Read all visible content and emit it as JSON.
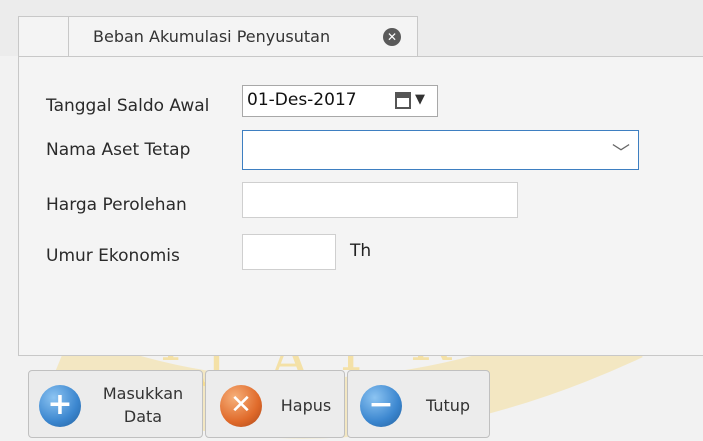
{
  "tab": {
    "title": "Beban Akumulasi Penyusutan",
    "close_glyph": "✕"
  },
  "form": {
    "tanggal_label": "Tanggal Saldo Awal",
    "tanggal_value": "01-Des-2017",
    "nama_aset_label": "Nama Aset Tetap",
    "nama_aset_value": "",
    "harga_label": "Harga Perolehan",
    "harga_value": "",
    "umur_label": "Umur Ekonomis",
    "umur_value": "",
    "umur_unit": "Th"
  },
  "buttons": {
    "masukkan_line1": "Masukkan",
    "masukkan_line2": "Data",
    "hapus": "Hapus",
    "tutup": "Tutup"
  },
  "icons": {
    "tab_close": "close-icon",
    "calendar": "calendar-icon",
    "dropdown": "chevron-down-icon",
    "add": "plus-icon",
    "delete": "x-icon",
    "close": "minus-icon"
  },
  "colors": {
    "combo_border": "#3e7fc1",
    "add_icon": "#3b86cf",
    "delete_icon": "#e06a2a",
    "close_icon": "#3b86cf"
  }
}
